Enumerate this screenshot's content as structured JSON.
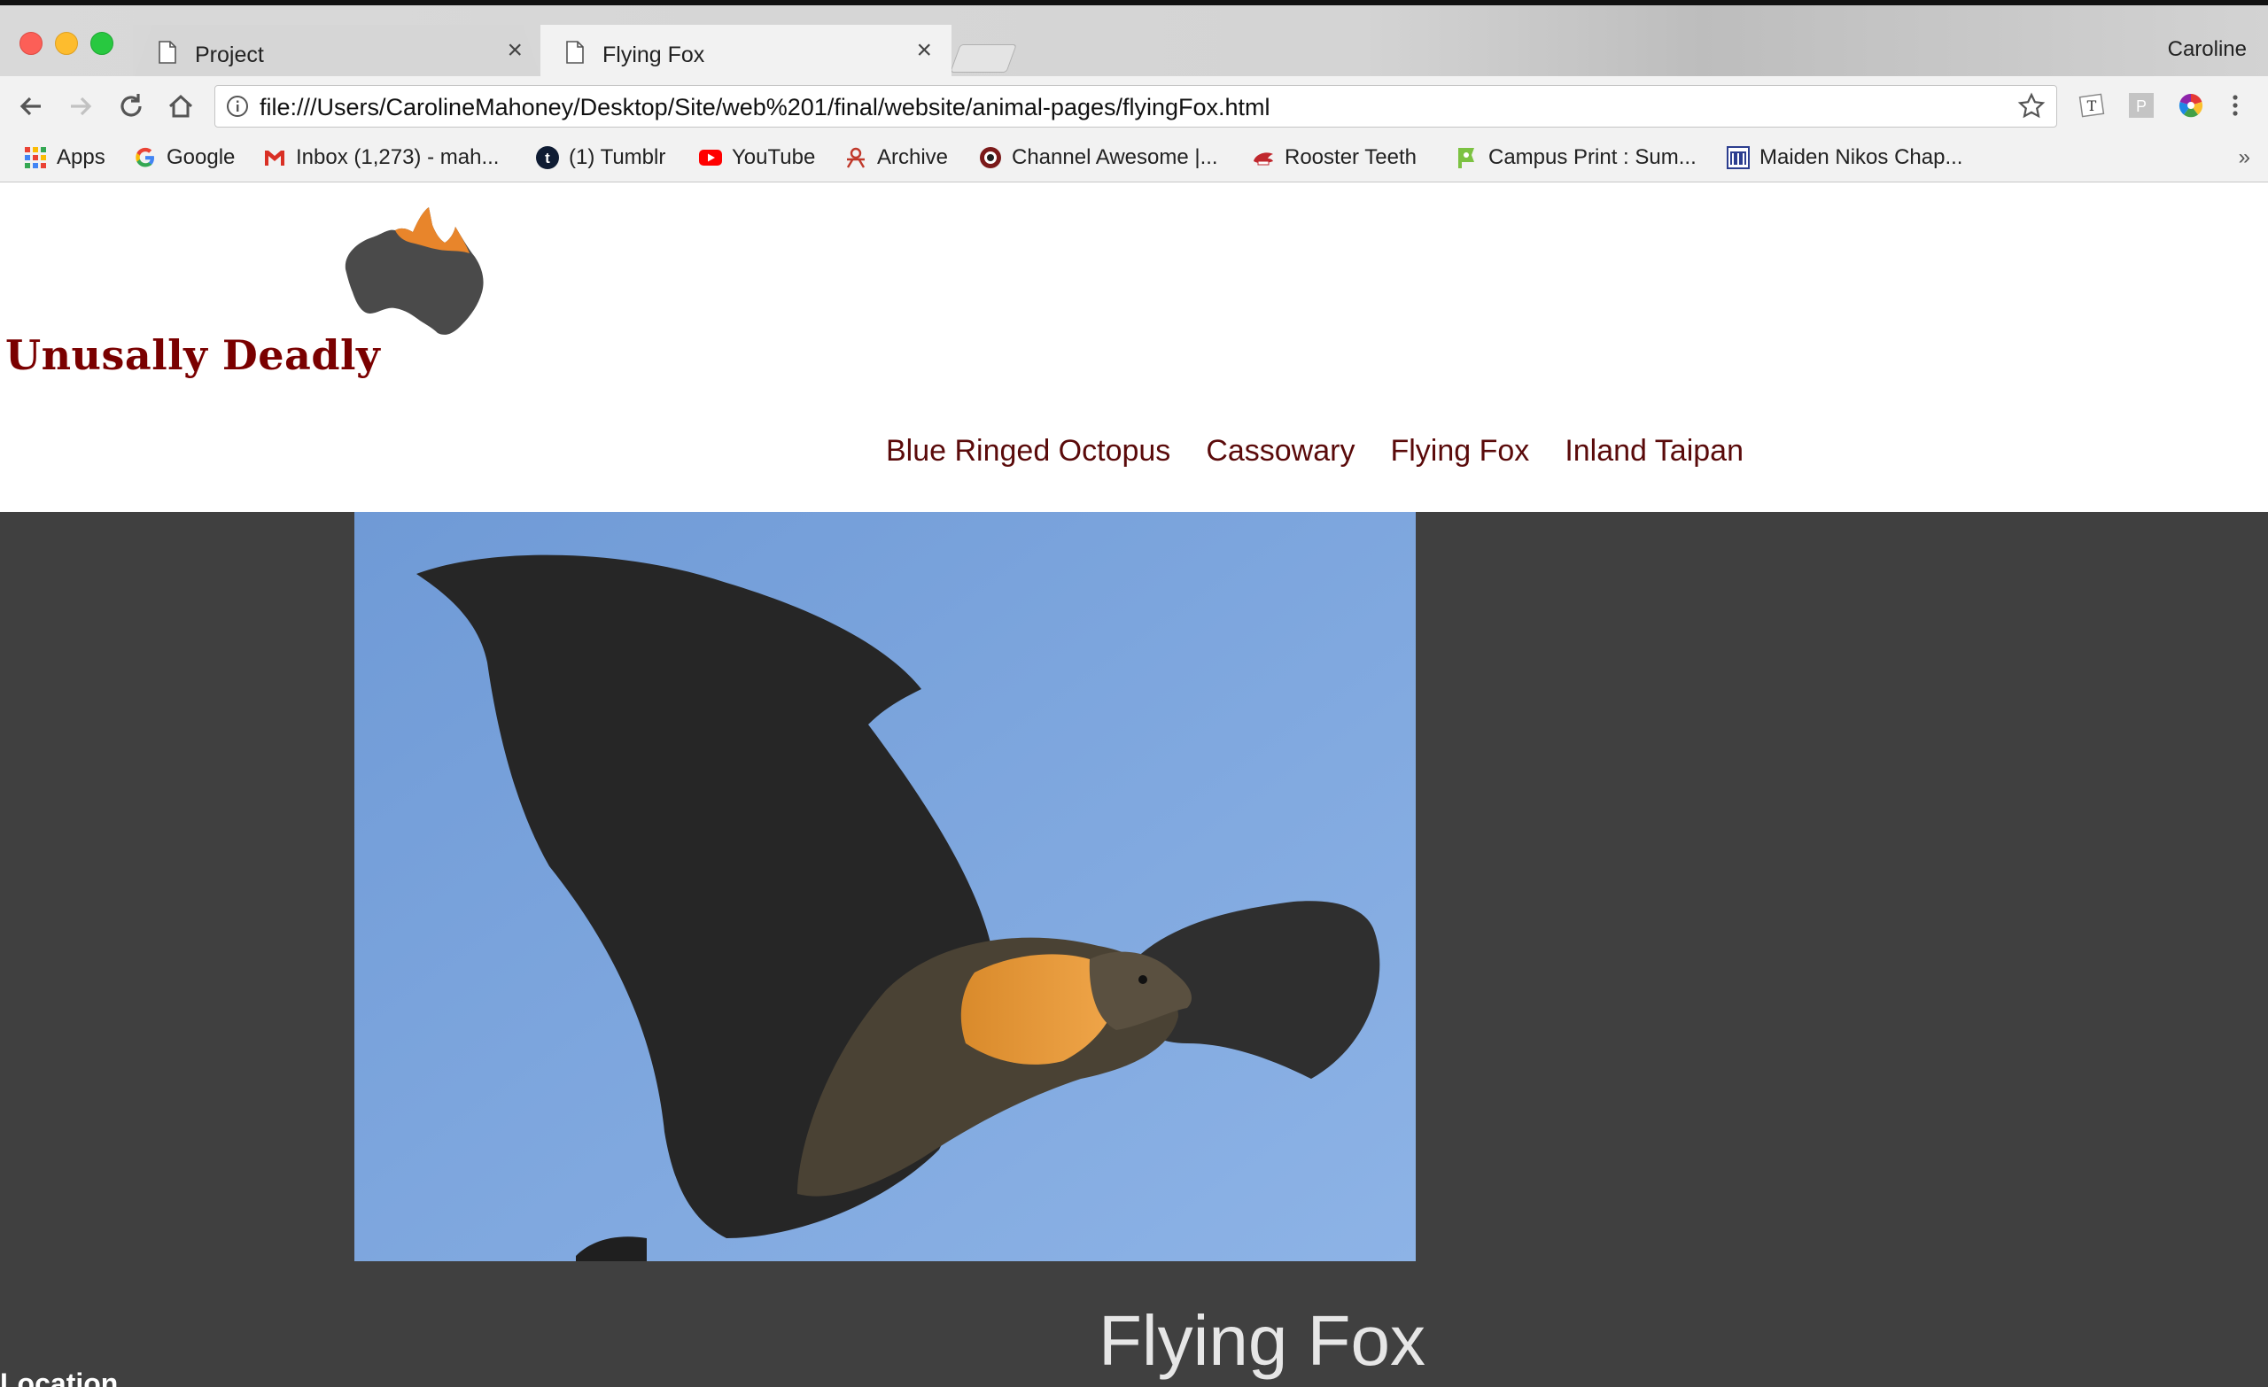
{
  "browser": {
    "tabs": [
      {
        "title": "Project",
        "close": "×"
      },
      {
        "title": "Flying Fox",
        "close": "×"
      }
    ],
    "profile_name": "Caroline",
    "address": "file:///Users/CarolineMahoney/Desktop/Site/web%201/final/website/animal-pages/flyingFox.html",
    "bookmarks": [
      {
        "label": "Apps",
        "icon": "apps-grid-icon"
      },
      {
        "label": "Google",
        "icon": "google-icon"
      },
      {
        "label": "Inbox (1,273) - mah...",
        "icon": "gmail-icon"
      },
      {
        "label": "(1) Tumblr",
        "icon": "tumblr-icon"
      },
      {
        "label": "YouTube",
        "icon": "youtube-icon"
      },
      {
        "label": "Archive",
        "icon": "archive-icon"
      },
      {
        "label": "Channel Awesome |...",
        "icon": "channel-awesome-icon"
      },
      {
        "label": "Rooster Teeth",
        "icon": "rooster-teeth-icon"
      },
      {
        "label": "Campus Print : Sum...",
        "icon": "campus-print-icon"
      },
      {
        "label": "Maiden Nikos Chap...",
        "icon": "maiden-nikos-icon"
      }
    ],
    "bookmarks_more": "»",
    "extensions": {
      "t": "T",
      "p": "P"
    }
  },
  "site": {
    "logo_text": "Unusally Deadly",
    "nav": [
      "Blue Ringed Octopus",
      "Cassowary",
      "Flying Fox",
      "Inland Taipan"
    ],
    "page_title": "Flying Fox",
    "section_label": "Location"
  },
  "colors": {
    "logo_red": "#7a0000",
    "nav_link": "#5a0a0a",
    "content_bg": "#404040",
    "sky": "#7aa6dd",
    "logo_orange": "#e8852b",
    "logo_gray": "#4a4a4a"
  }
}
